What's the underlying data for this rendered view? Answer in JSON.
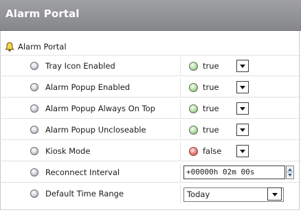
{
  "panel": {
    "title": "Alarm Portal",
    "root_label": "Alarm Portal",
    "colors": {
      "titlebar": "#8f9093",
      "title_text": "#ffffff",
      "true_icon": "#8fc47c",
      "false_icon": "#e05a5a"
    }
  },
  "properties": [
    {
      "label": "Tray Icon Enabled",
      "value": "true",
      "icon": "green-dot-icon"
    },
    {
      "label": "Alarm Popup Enabled",
      "value": "true",
      "icon": "green-dot-icon"
    },
    {
      "label": "Alarm Popup Always On Top",
      "value": "true",
      "icon": "green-dot-icon"
    },
    {
      "label": "Alarm Popup Uncloseable",
      "value": "true",
      "icon": "green-dot-icon"
    },
    {
      "label": "Kiosk Mode",
      "value": "false",
      "icon": "red-dot-icon"
    },
    {
      "label": "Reconnect Interval",
      "value": "+00000h 02m 00s"
    },
    {
      "label": "Default Time Range",
      "value": "Today"
    }
  ]
}
